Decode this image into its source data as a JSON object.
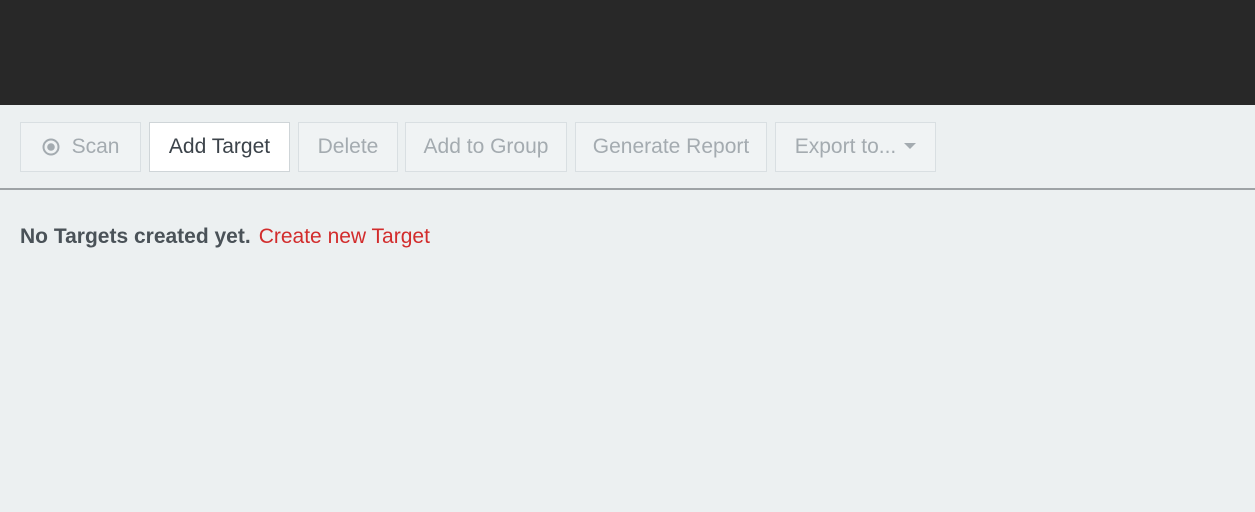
{
  "toolbar": {
    "scan_label": "Scan",
    "add_target_label": "Add Target",
    "delete_label": "Delete",
    "add_to_group_label": "Add to Group",
    "generate_report_label": "Generate Report",
    "export_label": "Export to..."
  },
  "content": {
    "empty_message": "No Targets created yet.",
    "create_link": "Create new Target"
  },
  "colors": {
    "header_background": "#282828",
    "page_background": "#ecf0f1",
    "link_color": "#d22c2c"
  },
  "icons": {
    "scan": "target-icon",
    "export": "caret-down-icon"
  }
}
